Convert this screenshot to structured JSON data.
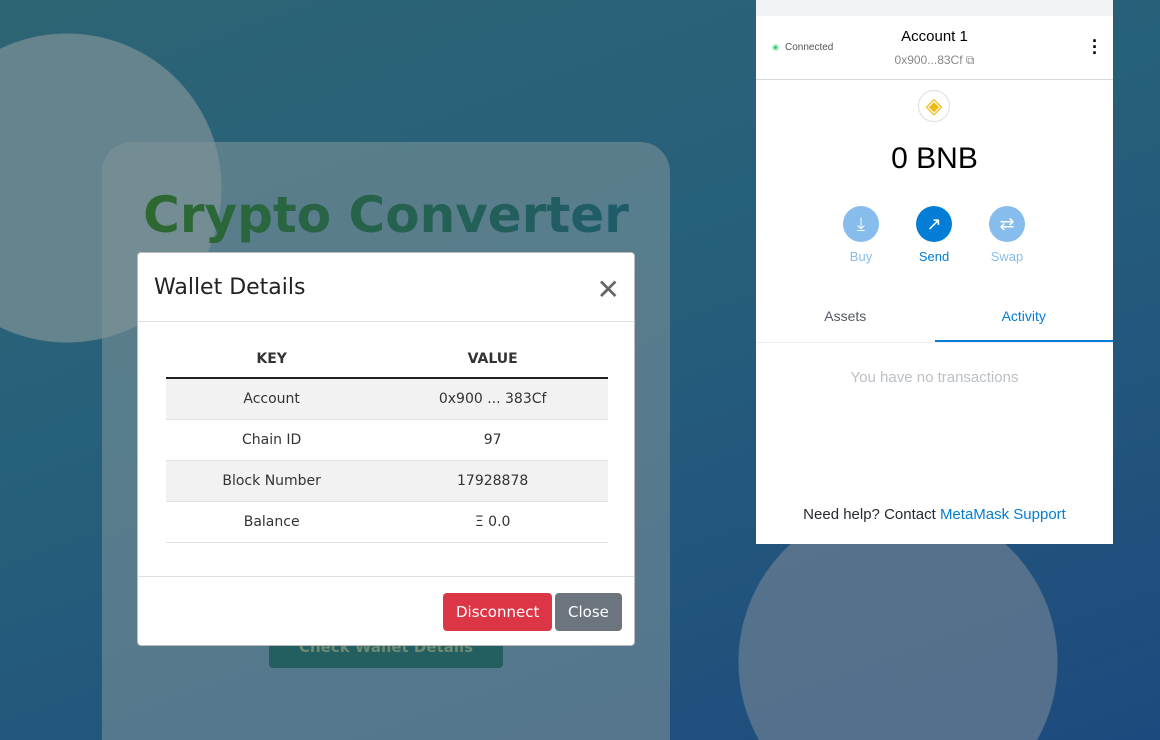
{
  "app": {
    "title": "Crypto Converter",
    "check_button": "Check Wallet Details"
  },
  "modal": {
    "title": "Wallet Details",
    "columns": [
      "KEY",
      "VALUE"
    ],
    "rows": [
      {
        "key": "Account",
        "value": "0x900 ... 383Cf"
      },
      {
        "key": "Chain ID",
        "value": "97"
      },
      {
        "key": "Block Number",
        "value": "17928878"
      },
      {
        "key": "Balance",
        "value": "Ξ 0.0"
      }
    ],
    "disconnect": "Disconnect",
    "close": "Close"
  },
  "metamask": {
    "status": "Connected",
    "account": "Account 1",
    "address": "0x900...83Cf",
    "balance": "0 BNB",
    "actions": [
      "Buy",
      "Send",
      "Swap"
    ],
    "tabs": [
      "Assets",
      "Activity"
    ],
    "active_tab": "Activity",
    "empty": "You have no transactions",
    "help_prefix": "Need help? Contact ",
    "help_link": "MetaMask Support",
    "colors": {
      "primary": "#037dd6",
      "light": "#86bdec",
      "bnb": "#f0b90b"
    }
  }
}
